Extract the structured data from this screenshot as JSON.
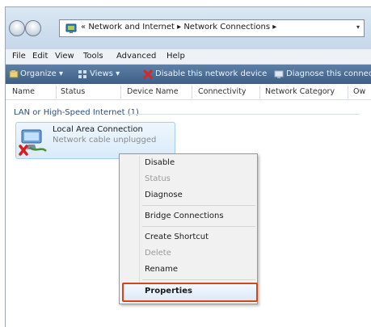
{
  "window": {
    "address": {
      "prefix": "«",
      "path": "Network and Internet ▸ Network Connections ▸",
      "dropdown": "▾"
    }
  },
  "menubar": [
    "File",
    "Edit",
    "View",
    "Tools",
    "Advanced",
    "Help"
  ],
  "toolbar": {
    "organize": "Organize ▾",
    "views": "Views ▾",
    "disable": "Disable this network device",
    "diagnose": "Diagnose this connec"
  },
  "columns": [
    "Name",
    "Status",
    "Device Name",
    "Connectivity",
    "Network Category",
    "Ow"
  ],
  "group": {
    "label": "LAN or High-Speed Internet (1)"
  },
  "connection": {
    "name": "Local Area Connection",
    "status": "Network cable unplugged"
  },
  "context_menu": {
    "items": [
      {
        "label": "Disable",
        "enabled": true
      },
      {
        "label": "Status",
        "enabled": false
      },
      {
        "label": "Diagnose",
        "enabled": true
      },
      {
        "label": "Bridge Connections",
        "enabled": true
      },
      {
        "label": "Create Shortcut",
        "enabled": true
      },
      {
        "label": "Delete",
        "enabled": false
      },
      {
        "label": "Rename",
        "enabled": true
      },
      {
        "label": "Properties",
        "enabled": true,
        "highlighted": true
      }
    ]
  },
  "colors": {
    "toolbar": "#4a6c94",
    "highlight_border": "#d0471c",
    "group_text": "#2b4f80"
  }
}
